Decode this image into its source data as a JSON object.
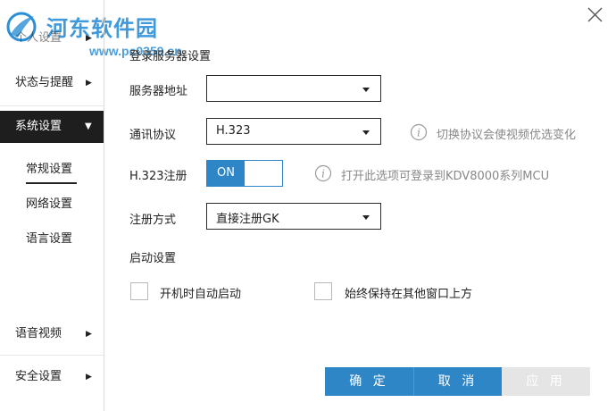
{
  "watermark": {
    "title": "河东软件园",
    "url": "www.pc0359.cn"
  },
  "sidebar": {
    "items": [
      {
        "label": "个人设置"
      },
      {
        "label": "状态与提醒"
      },
      {
        "label": "系统设置"
      },
      {
        "label": "语音视频"
      },
      {
        "label": "安全设置"
      }
    ],
    "sub_items": [
      {
        "label": "常规设置"
      },
      {
        "label": "网络设置"
      },
      {
        "label": "语言设置"
      }
    ]
  },
  "content": {
    "section_title": "登录服务器设置",
    "server_address": {
      "label": "服务器地址",
      "value": ""
    },
    "protocol": {
      "label": "通讯协议",
      "value": "H.323",
      "hint": "切换协议会使视频优选变化"
    },
    "h323_register": {
      "label": "H.323注册",
      "toggle_label": "ON",
      "state": "on",
      "hint": "打开此选项可登录到KDV8000系列MCU"
    },
    "register_mode": {
      "label": "注册方式",
      "value": "直接注册GK"
    },
    "startup": {
      "title": "启动设置",
      "auto_start": {
        "label": "开机时自动启动",
        "checked": false
      },
      "always_on_top": {
        "label": "始终保持在其他窗口上方",
        "checked": false
      }
    }
  },
  "buttons": {
    "ok": "确 定",
    "cancel": "取 消",
    "apply": "应 用"
  },
  "colors": {
    "accent": "#2f86c7",
    "active_nav_bg": "#1e1e1e",
    "disabled_button": "#e5e5e5",
    "watermark": "#2b8ed6"
  }
}
